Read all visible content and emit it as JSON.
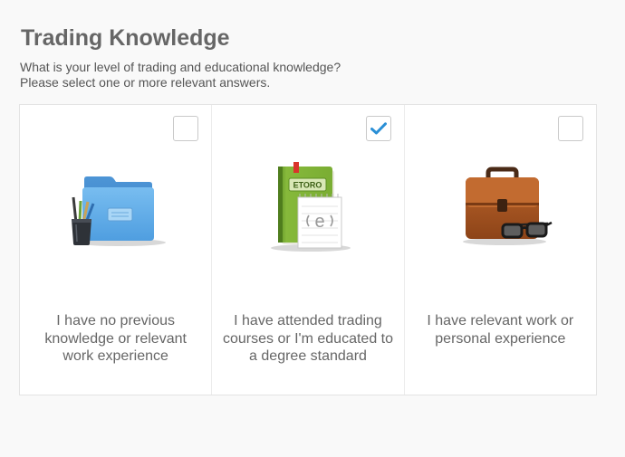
{
  "header": {
    "title": "Trading Knowledge",
    "subtitle_line1": "What is your level of trading and educational knowledge?",
    "subtitle_line2": "Please select one or more relevant answers."
  },
  "options": [
    {
      "icon": "folder-with-pens-icon",
      "label_lines": [
        "I have no previous",
        "knowledge or relevant",
        "work experience"
      ],
      "checked": false
    },
    {
      "icon": "etoro-book-icon",
      "book_text": "ETORO",
      "label_lines": [
        "I have attended trading",
        "courses or I'm educated to",
        "a degree standard"
      ],
      "checked": true
    },
    {
      "icon": "briefcase-with-glasses-icon",
      "label_lines": [
        "I have relevant work or",
        "personal experience"
      ],
      "checked": false
    }
  ],
  "colors": {
    "check_mark": "#2a8fd6",
    "text": "#666666",
    "checkbox_border": "#c9c9c9"
  }
}
